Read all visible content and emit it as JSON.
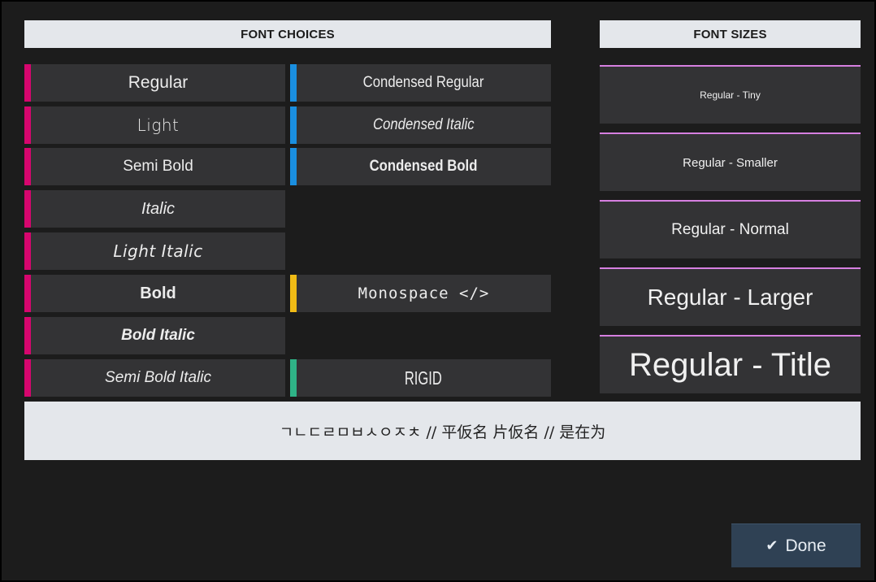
{
  "font_choices": {
    "header": "FONT CHOICES",
    "left_column": [
      {
        "label": "Regular"
      },
      {
        "label": "Light"
      },
      {
        "label": "Semi Bold"
      },
      {
        "label": "Italic"
      },
      {
        "label": "Light Italic"
      },
      {
        "label": "Bold"
      },
      {
        "label": "Bold Italic"
      },
      {
        "label": "Semi Bold Italic"
      }
    ],
    "right_column": [
      {
        "label": "Condensed Regular"
      },
      {
        "label": "Condensed Italic"
      },
      {
        "label": "Condensed Bold"
      },
      {
        "label": "Monospace </>"
      },
      {
        "label": "RIGID"
      }
    ]
  },
  "font_sizes": {
    "header": "FONT SIZES",
    "items": [
      {
        "label": "Regular - Tiny"
      },
      {
        "label": "Regular - Smaller"
      },
      {
        "label": "Regular - Normal"
      },
      {
        "label": "Regular - Larger"
      },
      {
        "label": "Regular - Title"
      }
    ]
  },
  "sample_text": "ㄱㄴㄷㄹㅁㅂㅅㅇㅈㅊ // 平仮名 片仮名 // 是在为",
  "done_button": {
    "label": "Done",
    "icon": "checkmark-icon"
  },
  "colors": {
    "regular_accent": "#d6066e",
    "condensed_accent": "#1a8fe0",
    "monospace_accent": "#f0bb16",
    "rigid_accent": "#2fb387",
    "size_accent": "#d67fe0",
    "header_bg": "#e4e7eb",
    "button_bg": "#333335",
    "done_bg": "#2f4154"
  }
}
